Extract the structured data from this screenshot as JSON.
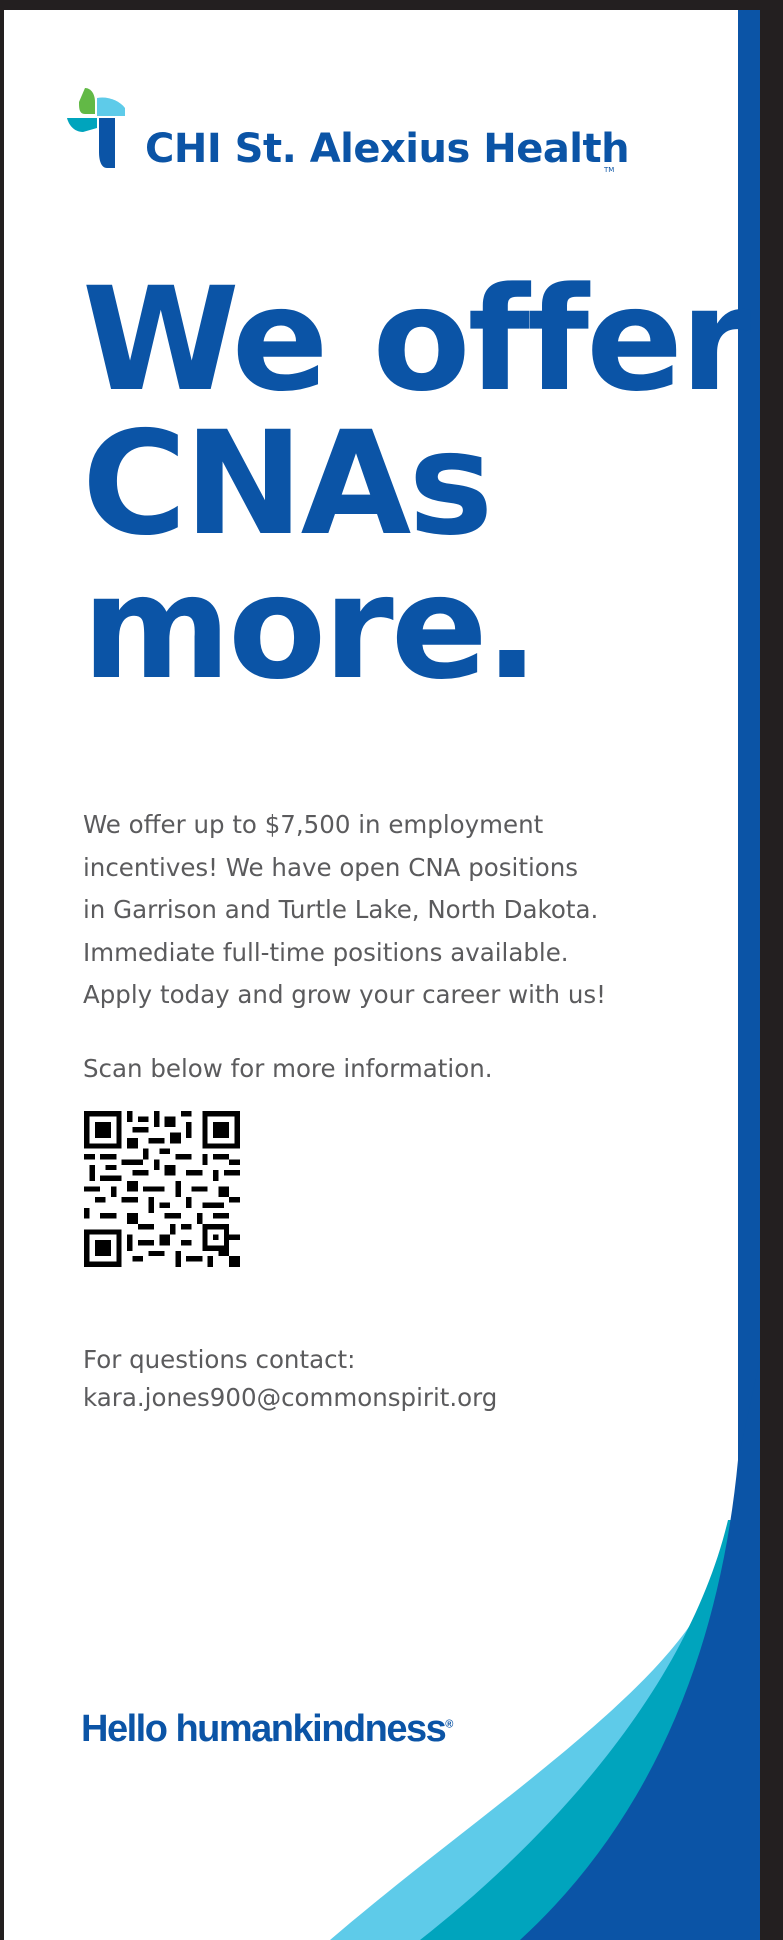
{
  "colors": {
    "brand_blue": "#0b54a6",
    "teal": "#00a4bd",
    "light_cyan": "#5ecbe9",
    "green": "#62b946",
    "text_gray": "#5b5b5d",
    "frame": "#231f20"
  },
  "logo": {
    "name": "CHI St. Alexius Health",
    "tm": "TM",
    "icon": "chi-cross-logo-icon"
  },
  "headline": {
    "line1": "We offer",
    "line2": "CNAs",
    "line3": "more."
  },
  "body": {
    "lines": [
      "We offer up to $7,500 in employment",
      "incentives! We have open CNA positions",
      "in Garrison and Turtle Lake, North Dakota.",
      "Immediate full-time positions available.",
      "Apply today and grow your career with us!"
    ]
  },
  "scan": {
    "text": "Scan below for more information.",
    "icon": "qr-code-icon"
  },
  "contact": {
    "label": "For questions contact:",
    "email": "kara.jones900@commonspirit.org"
  },
  "tagline": {
    "text": "Hello humankindness",
    "reg": "®"
  }
}
